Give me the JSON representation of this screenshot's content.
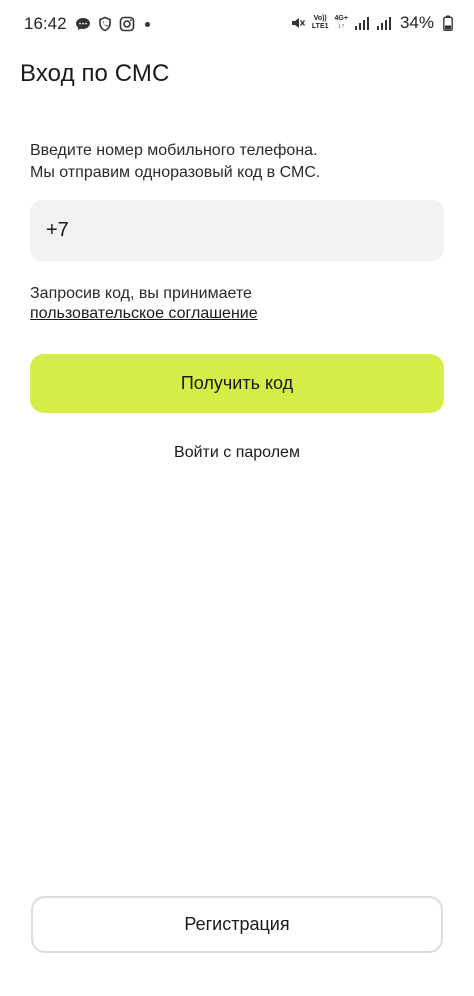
{
  "status_bar": {
    "time": "16:42",
    "left_icons": [
      "chat-bubble-icon",
      "shield-icon",
      "instagram-icon",
      "dot-icon"
    ],
    "net_top": "Vo))",
    "net_bottom": "LTE1",
    "net2_top": "4G+",
    "net2_bottom": "↓↑",
    "battery": "34%"
  },
  "page": {
    "title": "Вход по СМС",
    "intro_line1": "Введите номер мобильного телефона.",
    "intro_line2": "Мы отправим одноразовый код в СМС.",
    "phone_value": "+7",
    "agreement_text": "Запросив код, вы принимаете",
    "agreement_link": "пользовательское соглашение",
    "primary_button": "Получить код",
    "password_login": "Войти с паролем",
    "register_button": "Регистрация"
  },
  "colors": {
    "accent": "#d8ec47",
    "input_bg": "#f2f2f2",
    "outline_border": "#dcdcdc"
  }
}
